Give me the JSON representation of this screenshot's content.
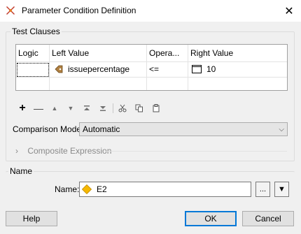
{
  "window": {
    "title": "Parameter Condition Definition"
  },
  "test_clauses": {
    "label": "Test Clauses",
    "columns": [
      "Logic",
      "Left Value",
      "Opera...",
      "Right Value"
    ],
    "rows": [
      {
        "logic": "",
        "left_value": "issuepercentage",
        "operator": "<=",
        "right_value": "10"
      }
    ]
  },
  "toolbar": {
    "buttons": [
      "add",
      "remove",
      "move-up",
      "move-down",
      "move-to-top",
      "move-to-bottom",
      "cut",
      "copy",
      "paste"
    ]
  },
  "comparison_mode": {
    "label": "Comparison Mode:",
    "value": "Automatic"
  },
  "composite_expression": {
    "label": "Composite Expression"
  },
  "name_section": {
    "group_label": "Name",
    "field_label": "Name:",
    "value": "E2",
    "browse_label": "..."
  },
  "buttons": {
    "help": "Help",
    "ok": "OK",
    "cancel": "Cancel"
  },
  "colors": {
    "accent": "#0078d7",
    "attribute_icon": "#b08040",
    "name_icon": "#f5b800"
  }
}
